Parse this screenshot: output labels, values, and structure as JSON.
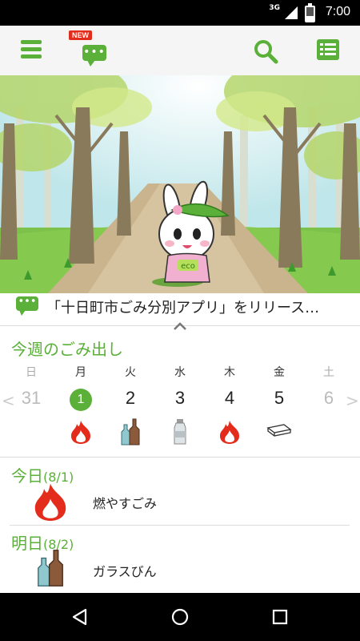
{
  "status": {
    "time": "7:00",
    "network": "3G"
  },
  "appbar": {
    "new_badge": "NEW"
  },
  "notice": {
    "text": "「十日町市ごみ分別アプリ」をリリース…",
    "bubble_glyph": "•••"
  },
  "week": {
    "title": "今週のごみ出し",
    "days": [
      {
        "dow": "日",
        "num": "31"
      },
      {
        "dow": "月",
        "num": "1"
      },
      {
        "dow": "火",
        "num": "2"
      },
      {
        "dow": "水",
        "num": "3"
      },
      {
        "dow": "木",
        "num": "4"
      },
      {
        "dow": "金",
        "num": "5"
      },
      {
        "dow": "土",
        "num": "6"
      }
    ],
    "prev_arrow": "<",
    "next_arrow": ">"
  },
  "today": {
    "label": "今日",
    "date": "(8/1)",
    "item": "燃やすごみ"
  },
  "tomorrow": {
    "label": "明日",
    "date": "(8/2)",
    "item": "ガラスびん"
  },
  "colors": {
    "accent": "#5ab038",
    "fire": "#e32c1b"
  },
  "icons": [
    "menu-icon",
    "chat-icon",
    "search-icon",
    "list-icon",
    "fire-icon",
    "bottles-icon",
    "plastic-bottle-icon",
    "tray-icon"
  ]
}
